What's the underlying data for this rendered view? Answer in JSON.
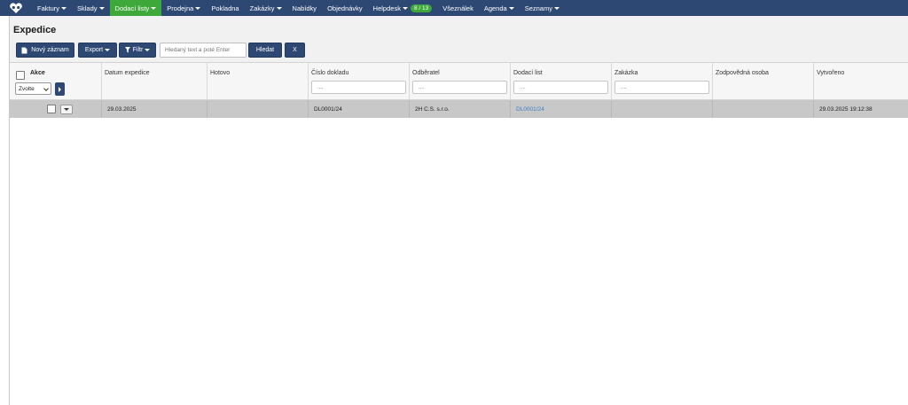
{
  "nav": {
    "items": [
      {
        "label": "Faktury",
        "dropdown": true
      },
      {
        "label": "Sklady",
        "dropdown": true
      },
      {
        "label": "Dodací listy",
        "dropdown": true,
        "active": true
      },
      {
        "label": "Prodejna",
        "dropdown": true
      },
      {
        "label": "Pokladna",
        "dropdown": false
      },
      {
        "label": "Zakázky",
        "dropdown": true
      },
      {
        "label": "Nabídky",
        "dropdown": false
      },
      {
        "label": "Objednávky",
        "dropdown": false
      },
      {
        "label": "Helpdesk",
        "dropdown": true,
        "badge": "8 / 13"
      },
      {
        "label": "Všeználek",
        "dropdown": false
      },
      {
        "label": "Agenda",
        "dropdown": true
      },
      {
        "label": "Seznamy",
        "dropdown": true
      }
    ],
    "logo_icon": "heart-logo-icon"
  },
  "page": {
    "title": "Expedice"
  },
  "toolbar": {
    "new_record_label": "Nový záznam",
    "export_label": "Export",
    "filter_label": "Filtr",
    "search_placeholder": "Hledaný text a poté Enter",
    "search_label": "Hledat",
    "clear_label": "X"
  },
  "table": {
    "actions_label": "Akce",
    "actions_select_value": "Zvolte",
    "columns": [
      {
        "label": "Datum expedice",
        "filter": false
      },
      {
        "label": "Hotovo",
        "filter": false
      },
      {
        "label": "Číslo dokladu",
        "filter": true,
        "placeholder": "...."
      },
      {
        "label": "Odběratel",
        "filter": true,
        "placeholder": "...."
      },
      {
        "label": "Dodací list",
        "filter": true,
        "placeholder": "...."
      },
      {
        "label": "Zakázka",
        "filter": true,
        "placeholder": "...."
      },
      {
        "label": "Zodpovědná osoba",
        "filter": false
      },
      {
        "label": "Vytvořeno",
        "filter": false
      }
    ],
    "rows": [
      {
        "datum_expedice": "29.03.2025",
        "hotovo": "",
        "cislo_dokladu": "DL0001/24",
        "odberatel": "2H C.S. s.r.o.",
        "dodaci_list": "DL0001/24",
        "zakazka": "",
        "zodpovedna_osoba": "",
        "vytvoreno": "29.03.2025 19:12:38"
      }
    ]
  },
  "colors": {
    "nav_bg": "#2e4874",
    "nav_active": "#3ea83a",
    "button_bg": "#2e4874",
    "row_bg": "#c8c8c8",
    "link": "#3b7fc4"
  }
}
